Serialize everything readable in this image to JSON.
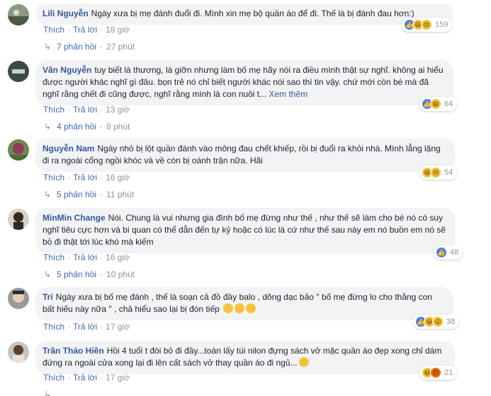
{
  "labels": {
    "like": "Thích",
    "reply": "Trả lời",
    "see_more": "Xem thêm"
  },
  "comments": [
    {
      "author": "Lili Nguyễn",
      "text": "Ngày xưa bị mẹ đánh đuổi đi. Mình xin mẹ bộ quần áo để đi. Thế là bị đánh đau hơn:)",
      "time": "18 giờ",
      "reactions": [
        "like-icon",
        "haha-icon",
        "sad-icon"
      ],
      "reaction_count": "159",
      "replies": "7 phản hồi",
      "replies_time": "27 phút"
    },
    {
      "author": "Vân Nguyễn",
      "text": "tuy biết là thương, là giỡn nhưng làm bố mẹ hãy nói ra điều mình thật sự nghĩ. không ai hiểu được người khác nghĩ gì đâu. bọn trẻ nó chỉ biết người khác nói sao thì tin vậy. chứ mới còn bé mà đã nghĩ rằng chết đi cũng được, nghĩ rằng mình là con nuôi t...",
      "see_more": true,
      "time": "13 giờ",
      "reactions": [
        "like-icon",
        "haha-icon"
      ],
      "reaction_count": "64",
      "replies": "4 phản hồi",
      "replies_time": "8 phút"
    },
    {
      "author": "Nguyễn Nam",
      "text": "Ngày nhỏ bị lột quần đánh vào mông đau chết khiếp, rồi bị đuổi ra khỏi nhà. Mình lẳng lặng đi ra ngoài cổng ngồi khóc và về còn bị oánh trận nữa. Hãi",
      "time": "16 giờ",
      "reactions": [
        "haha-icon",
        "sad-icon"
      ],
      "reaction_count": "54",
      "replies": "5 phản hồi",
      "replies_time": "11 phút"
    },
    {
      "author": "MinMin Change",
      "text": "Nói. Chung là vui nhưng gia đình bố mẹ đừng như thế , như thế sẽ làm cho bé nó có suy nghĩ tiêu cực hơn và bi quan có thể dẫn đến tự kỷ hoặc có lúc là cứ như thế sau này em nó buồn em nó sẽ bỏ đi thật tới lúc khó mà kiếm",
      "time": "16 giờ",
      "reactions": [
        "like-icon"
      ],
      "reaction_count": "48",
      "replies": "5 phản hồi",
      "replies_time": "10 phút"
    },
    {
      "author": "Trí",
      "text": "Ngày xưa bị bố mẹ đánh , thế là soạn cả đồ đầy balo , dõng dạc bảo \" bố mẹ đừng lo cho thằng con bất hiếu này nữa \" , chả hiểu sao lại bị đòn tiếp",
      "trailing_emojis": 3,
      "time": "17 giờ",
      "reactions": [
        "like-icon",
        "haha-icon",
        "wow-icon"
      ],
      "reaction_count": "38",
      "replies": "",
      "replies_time": ""
    },
    {
      "author": "Trần Thảo Hiền",
      "text": "Hồi 4 tuổi t đòi bỏ đi đầy...toàn lấy túi nilon đựng sách vở mặc quần áo đẹp xong chỉ dám đứng ra ngoài cửa xong lại đi lên cất sách vở thay quần áo đi ngủ...",
      "trailing_emojis": 1,
      "time": "17 giờ",
      "reactions": [
        "haha-icon",
        "angry-icon"
      ],
      "reaction_count": "21",
      "replies": "",
      "replies_time": ""
    }
  ]
}
